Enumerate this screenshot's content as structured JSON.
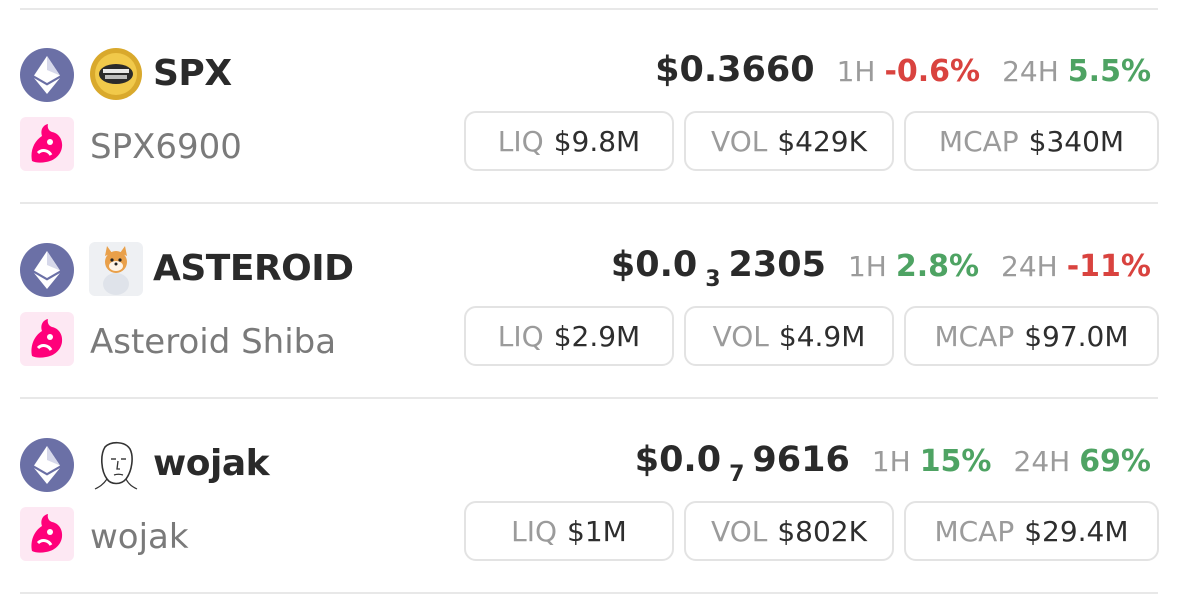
{
  "tokens": [
    {
      "symbol": "SPX",
      "name": "SPX6900",
      "chain_icon": "ethereum-icon",
      "dex_icon": "uniswap-icon",
      "token_icon": "spx-coin-icon",
      "price_main": "$0.3660",
      "price_sub": "",
      "price_tail": "",
      "h1_label": "1H",
      "h1_change": "-0.6%",
      "h1_direction": "down",
      "h24_label": "24H",
      "h24_change": "5.5%",
      "h24_direction": "up",
      "liq_label": "LIQ",
      "liq_value": "$9.8M",
      "vol_label": "VOL",
      "vol_value": "$429K",
      "mcap_label": "MCAP",
      "mcap_value": "$340M"
    },
    {
      "symbol": "ASTEROID",
      "name": "Asteroid Shiba",
      "chain_icon": "ethereum-icon",
      "dex_icon": "uniswap-icon",
      "token_icon": "shiba-astronaut-icon",
      "price_main": "$0.0",
      "price_sub": "3",
      "price_tail": "2305",
      "h1_label": "1H",
      "h1_change": "2.8%",
      "h1_direction": "up",
      "h24_label": "24H",
      "h24_change": "-11%",
      "h24_direction": "down",
      "liq_label": "LIQ",
      "liq_value": "$2.9M",
      "vol_label": "VOL",
      "vol_value": "$4.9M",
      "mcap_label": "MCAP",
      "mcap_value": "$97.0M"
    },
    {
      "symbol": "wojak",
      "name": "wojak",
      "chain_icon": "ethereum-icon",
      "dex_icon": "uniswap-icon",
      "token_icon": "wojak-face-icon",
      "price_main": "$0.0",
      "price_sub": "7",
      "price_tail": "9616",
      "h1_label": "1H",
      "h1_change": "15%",
      "h1_direction": "up",
      "h24_label": "24H",
      "h24_change": "69%",
      "h24_direction": "up",
      "liq_label": "LIQ",
      "liq_value": "$1M",
      "vol_label": "VOL",
      "vol_value": "$802K",
      "mcap_label": "MCAP",
      "mcap_value": "$29.4M"
    }
  ],
  "colors": {
    "negative": "#d9433f",
    "positive": "#4ea363",
    "ethereum_bg": "#6b70a6",
    "uniswap_pink": "#ff007a"
  }
}
